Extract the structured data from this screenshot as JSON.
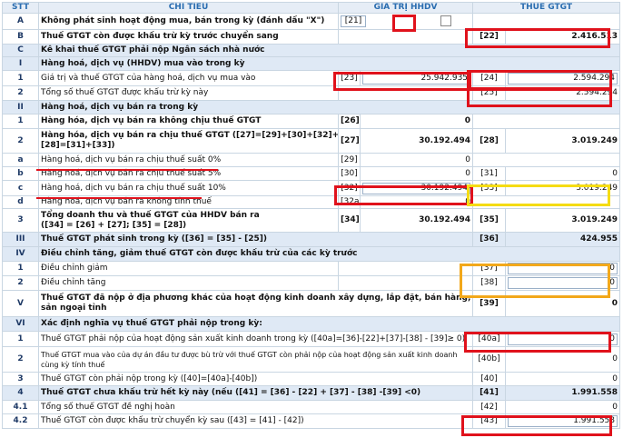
{
  "header": {
    "stt": "STT",
    "chi_tieu": "CHỈ TIÊU",
    "gia_tri": "GIÁ TRỊ HHDV",
    "thue": "THUẾ GTGT"
  },
  "rows": {
    "A": {
      "stt": "A",
      "label": "Không phát sinh hoạt động mua, bán trong kỳ (đánh dấu \"X\")",
      "code": "[21]"
    },
    "B": {
      "stt": "B",
      "label": "Thuế GTGT còn được khấu trừ kỳ trước chuyển sang",
      "code": "[22]",
      "value": "2.416.513"
    },
    "C": {
      "stt": "C",
      "label": "Kê khai thuế GTGT phải nộp Ngân sách nhà nước"
    },
    "I": {
      "stt": "I",
      "label": "Hàng hoá, dịch vụ (HHDV) mua vào trong kỳ"
    },
    "r1": {
      "stt": "1",
      "label": "Giá trị và thuế GTGT của hàng hoá, dịch vụ mua vào",
      "code1": "[23]",
      "value1": "25.942.935",
      "code2": "[24]",
      "value2": "2.594.294"
    },
    "r2": {
      "stt": "2",
      "label": "Tổng số thuế GTGT được khấu trừ kỳ này",
      "code2": "[25]",
      "value2": "2.594.294"
    },
    "II": {
      "stt": "II",
      "label": "Hàng hoá, dịch vụ bán ra trong kỳ"
    },
    "ii1": {
      "stt": "1",
      "label": "Hàng hóa, dịch vụ bán ra không chịu thuế GTGT",
      "code1": "[26]",
      "value1": "0"
    },
    "ii2": {
      "stt": "2",
      "label_1": "Hàng hóa, dịch vụ bán ra chịu thuế GTGT ([27]=[29]+[30]+[32]+[32a];",
      "label_2": "[28]=[31]+[33])",
      "code1": "[27]",
      "value1": "30.192.494",
      "code2": "[28]",
      "value2": "3.019.249"
    },
    "a": {
      "stt": "a",
      "label": "Hàng hoá, dịch vụ bán ra chịu thuế suất 0%",
      "code1": "[29]",
      "value1": "0"
    },
    "b": {
      "stt": "b",
      "label": "Hàng hoá, dịch vụ bán ra chịu thuế suất 5%",
      "code1": "[30]",
      "value1": "0",
      "code2": "[31]",
      "value2": "0"
    },
    "c": {
      "stt": "c",
      "label": "Hàng hoá, dịch vụ bán ra chịu thuế suất 10%",
      "code1": "[32]",
      "value1": "30.192.494",
      "code2": "[33]",
      "value2": "3.019.249"
    },
    "d": {
      "stt": "d",
      "label": "Hàng hoá, dịch vụ bán ra không tính thuế",
      "code1": "[32a]",
      "value1": "0"
    },
    "ii3": {
      "stt": "3",
      "label_1": "Tổng doanh thu và thuế GTGT của HHDV bán ra",
      "label_2": "([34] = [26] + [27]; [35] = [28])",
      "code1": "[34]",
      "value1": "30.192.494",
      "code2": "[35]",
      "value2": "3.019.249"
    },
    "III": {
      "stt": "III",
      "label": "Thuế GTGT phát sinh trong kỳ ([36] = [35] - [25])",
      "code2": "[36]",
      "value2": "424.955"
    },
    "IV": {
      "stt": "IV",
      "label": "Điều chỉnh tăng, giảm thuế GTGT còn được khấu trừ của các kỳ trước"
    },
    "iv1": {
      "stt": "1",
      "label": "Điều chỉnh giảm",
      "code2": "[37]",
      "value2": "0"
    },
    "iv2": {
      "stt": "2",
      "label": "Điều chỉnh tăng",
      "code2": "[38]",
      "value2": "0"
    },
    "V": {
      "stt": "V",
      "label_1": "Thuế GTGT đã nộp ở địa phương khác của hoạt động kinh doanh xây dựng, lắp đặt, bán hàng, bất động",
      "label_2": "sản ngoại tỉnh",
      "code2": "[39]",
      "value2": "0"
    },
    "VI": {
      "stt": "VI",
      "label": "Xác định nghĩa vụ thuế GTGT phải nộp trong kỳ:"
    },
    "vi1": {
      "stt": "1",
      "label": "Thuế GTGT phải nộp của hoạt động sản xuất kinh doanh trong kỳ ([40a]=[36]-[22]+[37]-[38] - [39]≥ 0)",
      "code2": "[40a]",
      "value2": "0"
    },
    "vi2": {
      "stt": "2",
      "label_1": "Thuế GTGT mua vào của dự án đầu tư được bù trừ với thuế GTGT còn phải nộp của hoạt động sản xuất kinh doanh",
      "label_2": "cùng kỳ tính thuế",
      "code2": "[40b]",
      "value2": "0"
    },
    "vi3": {
      "stt": "3",
      "label": "Thuế GTGT còn phải nộp trong kỳ ([40]=[40a]-[40b])",
      "code2": "[40]",
      "value2": "0"
    },
    "vi4": {
      "stt": "4",
      "label": "Thuế GTGT chưa khấu trừ hết kỳ này (nếu ([41] = [36] - [22] + [37] - [38] -[39] <0)",
      "code2": "[41]",
      "value2": "1.991.558"
    },
    "vi41": {
      "stt": "4.1",
      "label": "Tổng số thuế GTGT đề nghị hoàn",
      "code2": "[42]",
      "value2": "0"
    },
    "vi42": {
      "stt": "4.2",
      "label": "Thuế GTGT còn được khấu trừ chuyển kỳ sau ([43] = [41] - [42])",
      "code2": "[43]",
      "value2": "1.991.558"
    }
  },
  "colors": {
    "highlight_red": "#e0121c",
    "highlight_yellow": "#f5dc14",
    "highlight_orange": "#f2a81b",
    "header_text": "#2a6db0",
    "section_bg": "#dfe9f5"
  }
}
